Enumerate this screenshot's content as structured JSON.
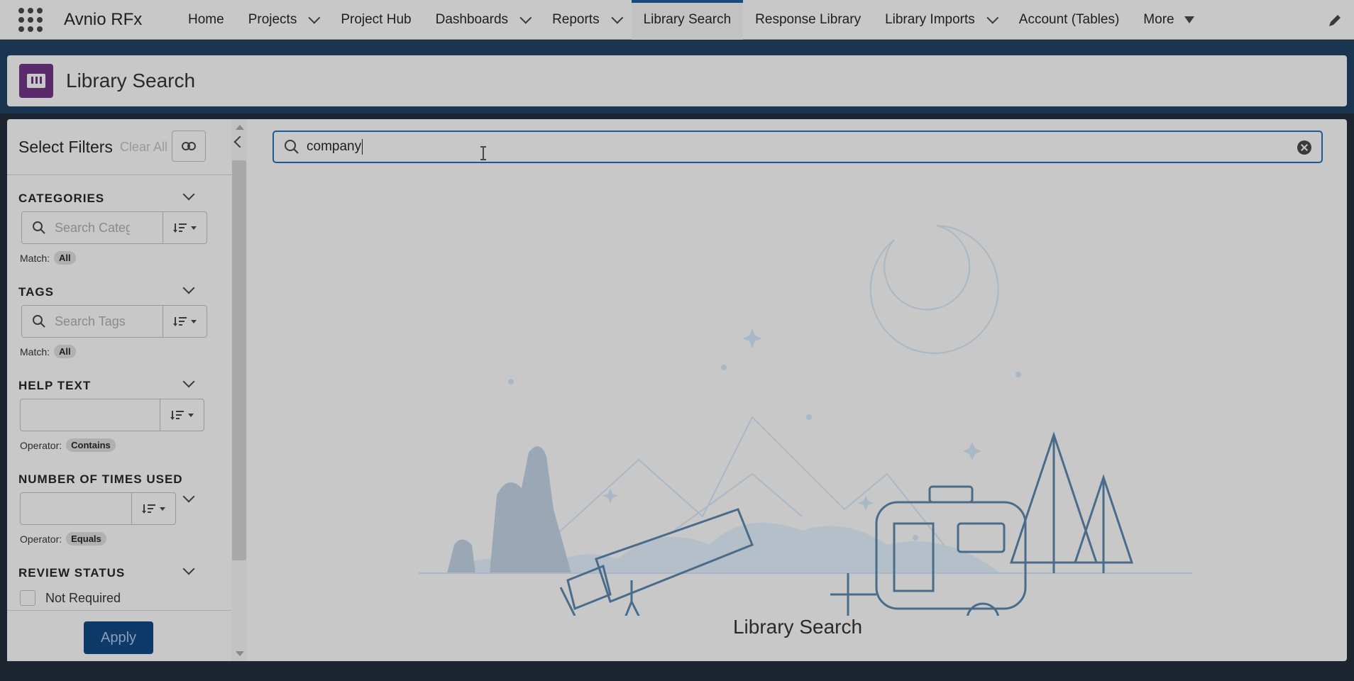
{
  "app": {
    "name": "Avnio RFx"
  },
  "nav": {
    "items": [
      {
        "label": "Home",
        "dropdown": false,
        "active": false
      },
      {
        "label": "Projects",
        "dropdown": true,
        "active": false
      },
      {
        "label": "Project Hub",
        "dropdown": false,
        "active": false
      },
      {
        "label": "Dashboards",
        "dropdown": true,
        "active": false
      },
      {
        "label": "Reports",
        "dropdown": true,
        "active": false
      },
      {
        "label": "Library Search",
        "dropdown": false,
        "active": true
      },
      {
        "label": "Response Library",
        "dropdown": false,
        "active": false
      },
      {
        "label": "Library Imports",
        "dropdown": true,
        "active": false
      },
      {
        "label": "Account (Tables)",
        "dropdown": false,
        "active": false
      },
      {
        "label": "More",
        "dropdown": "triangle",
        "active": false
      }
    ],
    "edit_icon": "pencil-icon"
  },
  "page": {
    "title": "Library Search",
    "icon": "book-icon"
  },
  "filters": {
    "title": "Select Filters",
    "clear_all": "Clear All",
    "categories": {
      "title": "CATEGORIES",
      "placeholder": "Search Categories",
      "match_label": "Match:",
      "match_value": "All"
    },
    "tags": {
      "title": "TAGS",
      "placeholder": "Search Tags",
      "match_label": "Match:",
      "match_value": "All"
    },
    "help_text": {
      "title": "HELP TEXT",
      "value": "",
      "operator_label": "Operator:",
      "operator_value": "Contains"
    },
    "times_used": {
      "title": "NUMBER OF TIMES USED",
      "value": "",
      "operator_label": "Operator:",
      "operator_value": "Equals"
    },
    "review_status": {
      "title": "REVIEW STATUS",
      "options": [
        "Not Required"
      ]
    },
    "apply_label": "Apply"
  },
  "search": {
    "value": "company"
  },
  "empty_state": {
    "title": "Library Search"
  },
  "colors": {
    "active_tab": "#164a7a",
    "apply_button": "#0e3a6a",
    "search_focus": "#1b5a92",
    "page_icon": "#5a2a6a"
  }
}
